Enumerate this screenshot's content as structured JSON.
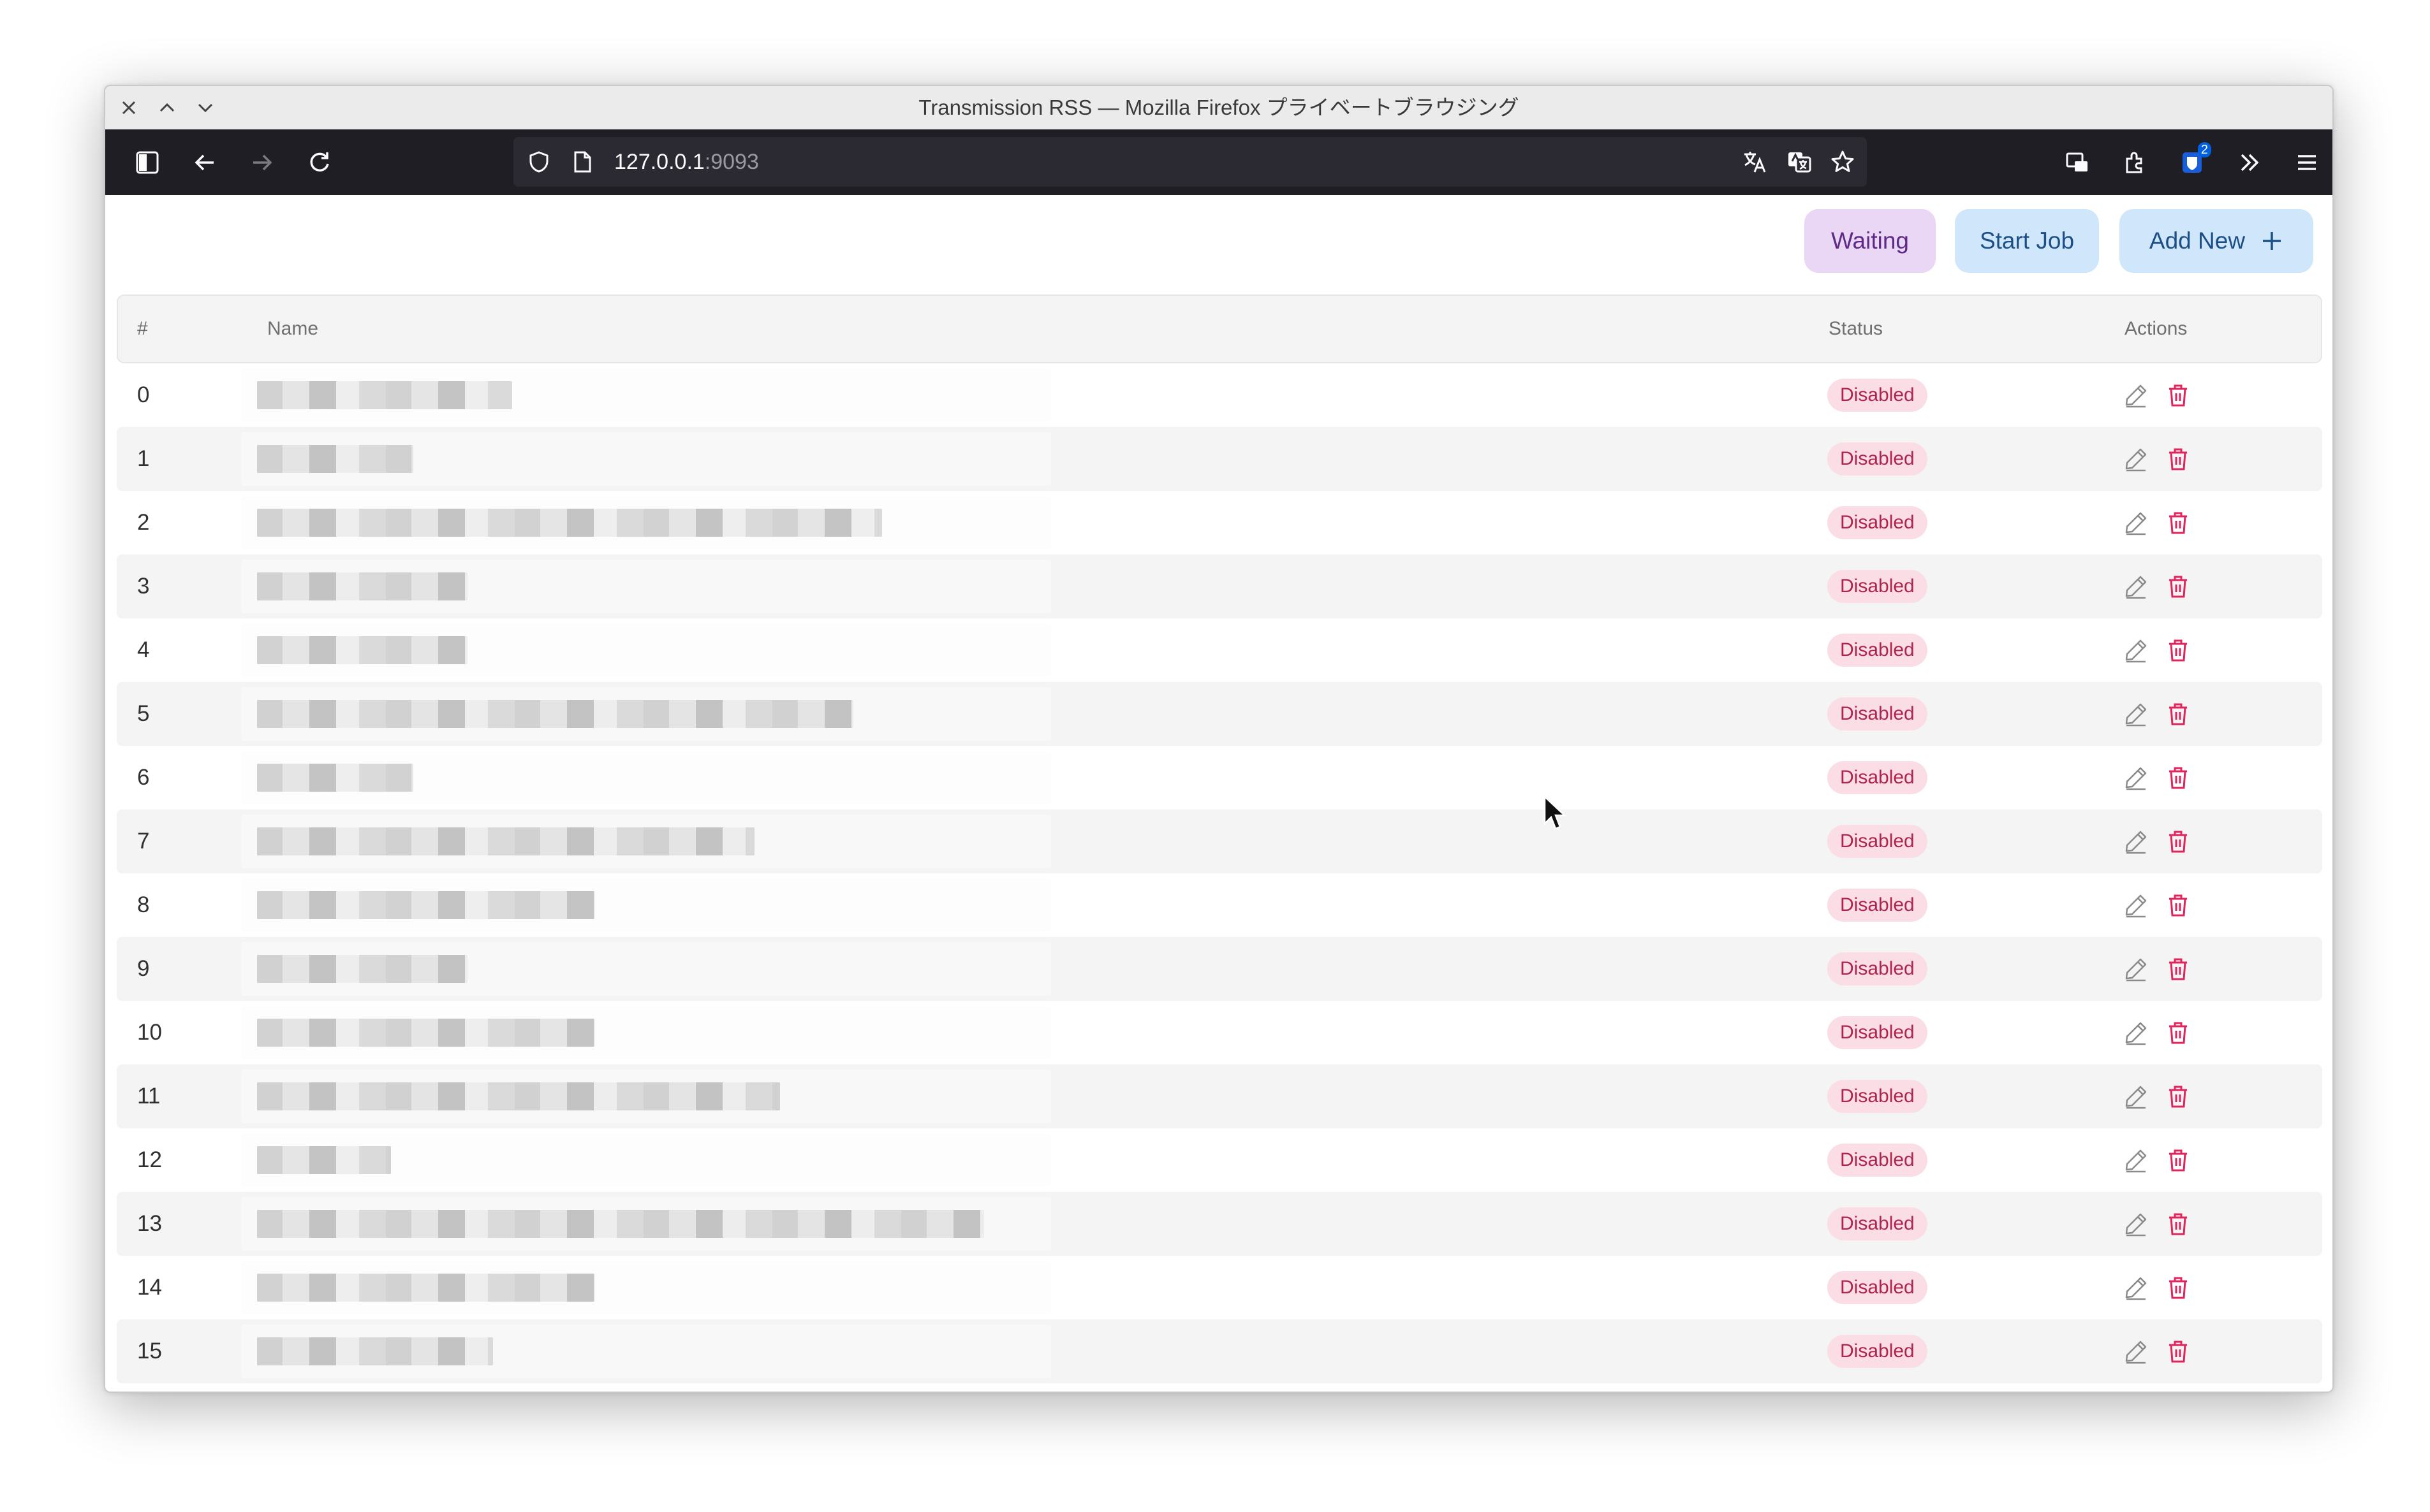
{
  "window": {
    "title": "Transmission RSS — Mozilla Firefox プライベートブラウジング"
  },
  "browser": {
    "url_host": "127.0.0.1",
    "url_port": ":9093",
    "extension_badge": "2"
  },
  "toolbar": {
    "waiting_label": "Waiting",
    "start_job_label": "Start Job",
    "add_new_label": "Add New"
  },
  "table": {
    "columns": {
      "index": "#",
      "name": "Name",
      "status": "Status",
      "actions": "Actions"
    },
    "rows": [
      {
        "index": "0",
        "status": "Disabled"
      },
      {
        "index": "1",
        "status": "Disabled"
      },
      {
        "index": "2",
        "status": "Disabled"
      },
      {
        "index": "3",
        "status": "Disabled"
      },
      {
        "index": "4",
        "status": "Disabled"
      },
      {
        "index": "5",
        "status": "Disabled"
      },
      {
        "index": "6",
        "status": "Disabled"
      },
      {
        "index": "7",
        "status": "Disabled"
      },
      {
        "index": "8",
        "status": "Disabled"
      },
      {
        "index": "9",
        "status": "Disabled"
      },
      {
        "index": "10",
        "status": "Disabled"
      },
      {
        "index": "11",
        "status": "Disabled"
      },
      {
        "index": "12",
        "status": "Disabled"
      },
      {
        "index": "13",
        "status": "Disabled"
      },
      {
        "index": "14",
        "status": "Disabled"
      },
      {
        "index": "15",
        "status": "Disabled"
      }
    ]
  },
  "colors": {
    "status_bg": "#fbdde6",
    "status_text": "#b0234d",
    "delete_icon": "#e0245e",
    "waiting_bg": "#e9d7f5",
    "primary_bg": "#cfe6fb"
  }
}
